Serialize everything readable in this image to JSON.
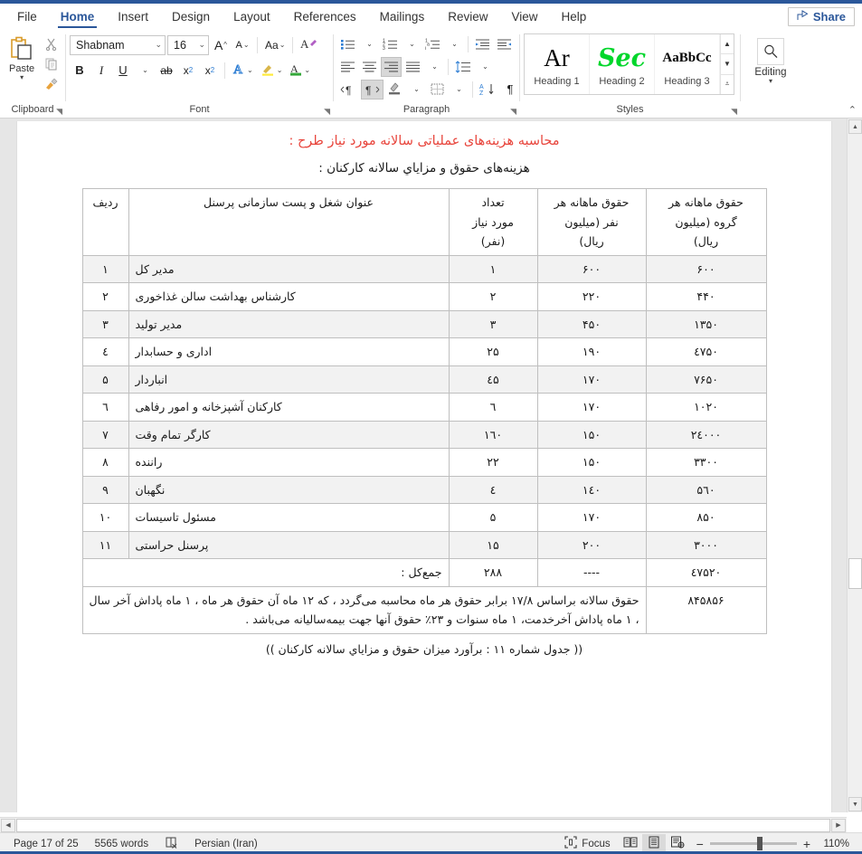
{
  "app": {
    "share_label": "Share"
  },
  "ribbon": {
    "tabs": [
      {
        "label": "File",
        "active": false
      },
      {
        "label": "Home",
        "active": true
      },
      {
        "label": "Insert",
        "active": false
      },
      {
        "label": "Design",
        "active": false
      },
      {
        "label": "Layout",
        "active": false
      },
      {
        "label": "References",
        "active": false
      },
      {
        "label": "Mailings",
        "active": false
      },
      {
        "label": "Review",
        "active": false
      },
      {
        "label": "View",
        "active": false
      },
      {
        "label": "Help",
        "active": false
      }
    ],
    "groups": {
      "clipboard": {
        "label": "Clipboard",
        "paste_label": "Paste",
        "cut_title": "Cut",
        "copy_title": "Copy",
        "format_painter_title": "Format Painter"
      },
      "font": {
        "label": "Font",
        "font_name": "Shabnam",
        "font_size": "16",
        "grow_font": "A",
        "shrink_font": "A",
        "change_case": "Aa",
        "clear_formatting": "A",
        "bold": "B",
        "italic": "I",
        "underline": "U",
        "strikethrough": "ab",
        "subscript": "x",
        "superscript": "x",
        "text_effects": "A",
        "highlight": "A",
        "font_color": "A"
      },
      "paragraph": {
        "label": "Paragraph"
      },
      "styles": {
        "label": "Styles",
        "items": [
          {
            "preview": "Ar",
            "name": "Heading 1",
            "color": "#000000"
          },
          {
            "preview": "Sec",
            "name": "Heading 2",
            "color": "#00d62b"
          },
          {
            "preview": "AaBbCc",
            "name": "Heading 3",
            "color": "#000000"
          }
        ]
      },
      "editing": {
        "label": "Editing"
      }
    }
  },
  "document": {
    "title": "محاسبه هزینه‌های عملیاتی سالانه مورد نیاز طرح :",
    "subtitle": "هزینه‌های حقوق و مزایاي سالانه کارکنان :",
    "table": {
      "headers": {
        "radif": "ردیف",
        "title": "عنوان شغل و پست سازمانی پرسنل",
        "count": "تعداد\nمورد نیاز\n(نفر)",
        "per_person": "حقوق ماهانه هر\nنفر (میلیون\nریال)",
        "per_group": "حقوق ماهانه هر\nگروه (میلیون\nریال)"
      },
      "rows": [
        {
          "radif": "۱",
          "title": "مدیر کل",
          "count": "۱",
          "per_person": "۶۰۰",
          "per_group": "۶۰۰"
        },
        {
          "radif": "۲",
          "title": "کارشناس بهداشت سالن غذاخوری",
          "count": "۲",
          "per_person": "۲۲۰",
          "per_group": "۴۴۰"
        },
        {
          "radif": "۳",
          "title": "مدیر تولید",
          "count": "۳",
          "per_person": "۴۵۰",
          "per_group": "۱۳۵۰"
        },
        {
          "radif": "٤",
          "title": "اداری و حسابدار",
          "count": "۲۵",
          "per_person": "۱۹۰",
          "per_group": "٤۷۵۰"
        },
        {
          "radif": "۵",
          "title": "انباردار",
          "count": "٤۵",
          "per_person": "۱۷۰",
          "per_group": "۷۶۵۰"
        },
        {
          "radif": "٦",
          "title": "کارکنان آشپزخانه و امور رفاهی",
          "count": "٦",
          "per_person": "۱۷۰",
          "per_group": "۱۰۲۰"
        },
        {
          "radif": "۷",
          "title": "کارگر تمام وقت",
          "count": "۱٦۰",
          "per_person": "۱۵۰",
          "per_group": "۲٤۰۰۰"
        },
        {
          "radif": "۸",
          "title": "راننده",
          "count": "۲۲",
          "per_person": "۱۵۰",
          "per_group": "۳۳۰۰"
        },
        {
          "radif": "۹",
          "title": "نگهبان",
          "count": "٤",
          "per_person": "۱٤۰",
          "per_group": "۵٦۰"
        },
        {
          "radif": "۱۰",
          "title": "مسئول تاسیسات",
          "count": "۵",
          "per_person": "۱۷۰",
          "per_group": "۸۵۰"
        },
        {
          "radif": "۱۱",
          "title": "پرسنل حراستی",
          "count": "۱۵",
          "per_person": "۲۰۰",
          "per_group": "۳۰۰۰"
        }
      ],
      "total": {
        "label": "جمع‌کل :",
        "count": "۲۸۸",
        "per_person": "----",
        "per_group": "٤۷۵۲۰"
      },
      "note": {
        "text": "حقوق سالانه براساس ۱۷/۸ برابر حقوق هر ماه محاسبه  می‌گردد ، که ۱۲ ماه آن حقوق هر ماه ، ۱ ماه پاداش آخر سال ، ۱ ماه پاداش آخرخدمت، ۱ ماه سنوات و ۲۳٪ حقوق آنها جهت بیمه‌سالیانه می‌باشد .",
        "value": "۸۴۵۸۵۶"
      },
      "caption": "(( جدول شماره ۱۱ : برآورد میزان حقوق و مزایاي سالانه کارکنان ))"
    }
  },
  "status": {
    "page": "Page 17 of 25",
    "words": "5565 words",
    "proofing_title": "Proofing errors",
    "language": "Persian (Iran)",
    "focus": "Focus",
    "read_mode_title": "Read Mode",
    "print_layout_title": "Print Layout",
    "web_layout_title": "Web Layout",
    "zoom_out": "−",
    "zoom_in": "+",
    "zoom_level": "110%"
  }
}
